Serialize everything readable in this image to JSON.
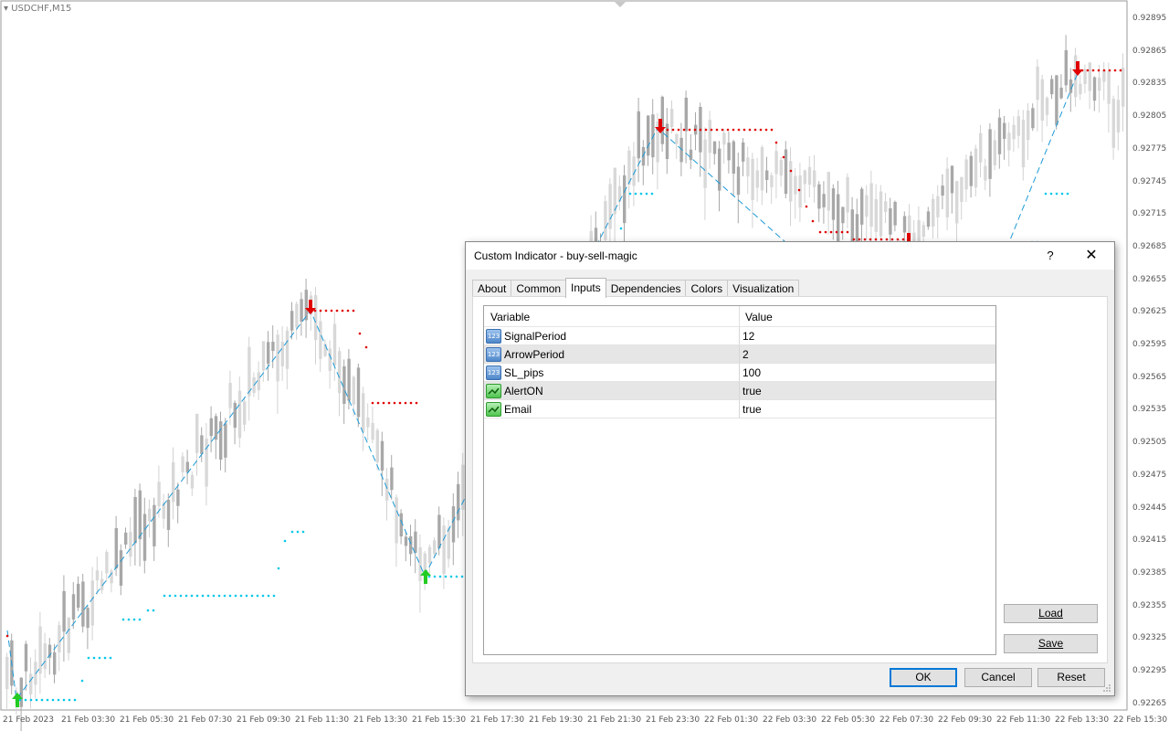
{
  "chart": {
    "symbol": "USDCHF,M15",
    "price_labels": [
      "0.92895",
      "0.92865",
      "0.92835",
      "0.92805",
      "0.92775",
      "0.92745",
      "0.92715",
      "0.92685",
      "0.92655",
      "0.92625",
      "0.92595",
      "0.92565",
      "0.92535",
      "0.92505",
      "0.92475",
      "0.92445",
      "0.92415",
      "0.92385",
      "0.92355",
      "0.92325",
      "0.92295",
      "0.92265"
    ],
    "time_labels": [
      "21 Feb 2023",
      "21 Feb 03:30",
      "21 Feb 05:30",
      "21 Feb 07:30",
      "21 Feb 09:30",
      "21 Feb 11:30",
      "21 Feb 13:30",
      "21 Feb 15:30",
      "21 Feb 17:30",
      "21 Feb 19:30",
      "21 Feb 21:30",
      "21 Feb 23:30",
      "22 Feb 01:30",
      "22 Feb 03:30",
      "22 Feb 05:30",
      "22 Feb 07:30",
      "22 Feb 09:30",
      "22 Feb 11:30",
      "22 Feb 13:30",
      "22 Feb 15:30"
    ],
    "colors": {
      "buy": "#00c8e8",
      "sell": "#e00000",
      "zigzag": "#1e9ad6",
      "up_arrow": "#22cc22",
      "down_arrow": "#e00000",
      "candle": "#c8c8c8"
    }
  },
  "dialog": {
    "title": "Custom Indicator - buy-sell-magic",
    "help": "?",
    "close": "✕",
    "tabs": [
      {
        "label": "About"
      },
      {
        "label": "Common"
      },
      {
        "label": "Inputs",
        "active": true
      },
      {
        "label": "Dependencies"
      },
      {
        "label": "Colors"
      },
      {
        "label": "Visualization"
      }
    ],
    "table": {
      "header_variable": "Variable",
      "header_value": "Value",
      "rows": [
        {
          "icon": "number-icon",
          "name": "SignalPeriod",
          "value": "12"
        },
        {
          "icon": "number-icon",
          "name": "ArrowPeriod",
          "value": "2"
        },
        {
          "icon": "number-icon",
          "name": "SL_pips",
          "value": "100"
        },
        {
          "icon": "boolean-icon",
          "name": "AlertON",
          "value": "true"
        },
        {
          "icon": "boolean-icon",
          "name": "Email",
          "value": "true"
        }
      ]
    },
    "load_label": "Load",
    "save_label": "Save",
    "ok_label": "OK",
    "cancel_label": "Cancel",
    "reset_label": "Reset"
  }
}
